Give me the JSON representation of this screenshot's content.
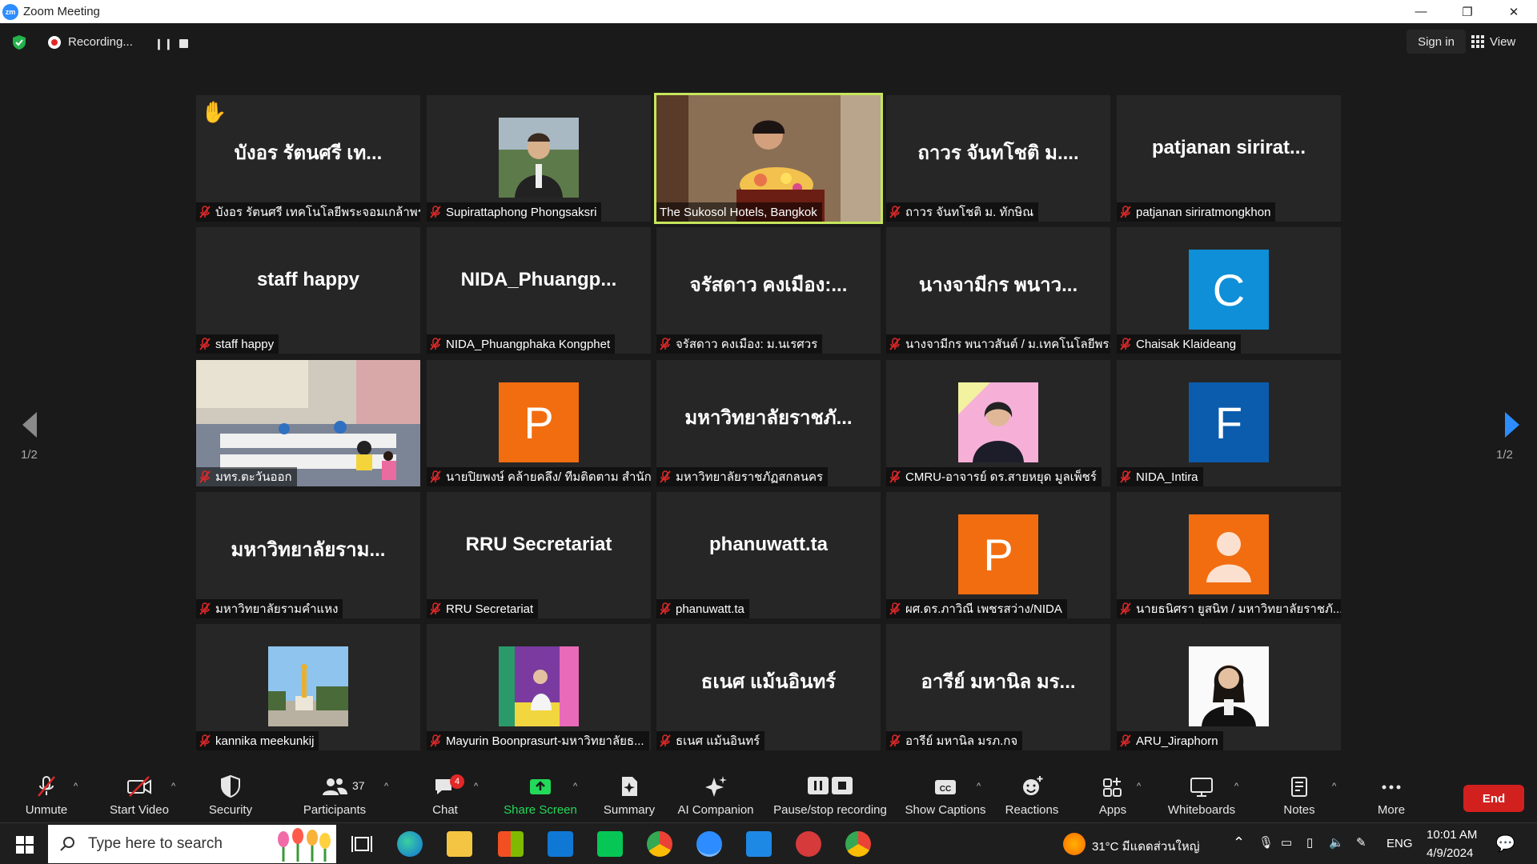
{
  "window": {
    "title": "Zoom Meeting",
    "logo_text": "zm",
    "minimize": "—",
    "restore": "❐",
    "close": "✕"
  },
  "topbar": {
    "recording_label": "Recording...",
    "signin_label": "Sign in",
    "view_label": "View"
  },
  "gallery": {
    "page_indicator_left": "1/2",
    "page_indicator_right": "1/2",
    "tiles": [
      {
        "display": "บังอร รัตนศรี เท...",
        "label": "บังอร รัตนศรี เทคโนโลยีพระจอมเกล้าพร...",
        "muted": true,
        "hand_raised": true
      },
      {
        "display": "",
        "label": "Supirattaphong Phongsaksri",
        "muted": true,
        "photo": "man-portrait"
      },
      {
        "display": "",
        "label": "The Sukosol Hotels, Bangkok",
        "muted": false,
        "photo": "speaker-podium",
        "speaking": true
      },
      {
        "display": "ถาวร จันทโชติ ม....",
        "label": "ถาวร จันทโชติ ม. ทักษิณ",
        "muted": true
      },
      {
        "display": "patjanan sirirat...",
        "label": "patjanan siriratmongkhon",
        "muted": true
      },
      {
        "display": "staff happy",
        "label": "staff happy",
        "muted": true
      },
      {
        "display": "NIDA_Phuangp...",
        "label": "NIDA_Phuangphaka Kongphet",
        "muted": true
      },
      {
        "display": "จรัสดาว คงเมือง:...",
        "label": "จรัสดาว คงเมือง: ม.นเรศวร",
        "muted": true
      },
      {
        "display": "นางจามีกร พนาว...",
        "label": "นางจามีกร พนาวสันต์ / ม.เทคโนโลยีพระ...",
        "muted": true
      },
      {
        "display": "",
        "label": "Chaisak Klaideang",
        "muted": true,
        "letter": "C",
        "letter_color": "#0e8fd8"
      },
      {
        "display": "",
        "label": "มทร.ตะวันออก",
        "muted": true,
        "photo": "classroom"
      },
      {
        "display": "",
        "label": "นายปิยพงษ์ คล้ายคลึง/ ทีมติดตาม สำนัก...",
        "muted": true,
        "letter": "P",
        "letter_color": "#f26d0f"
      },
      {
        "display": "มหาวิทยาลัยราชภั...",
        "label": "มหาวิทยาลัยราชภัฏสกลนคร",
        "muted": true
      },
      {
        "display": "",
        "label": "CMRU-อาจารย์ ดร.สายหยุด มูลเพ็ชร์",
        "muted": true,
        "photo": "woman-pink"
      },
      {
        "display": "",
        "label": "NIDA_Intira",
        "muted": true,
        "letter": "F",
        "letter_color": "#0b5cad"
      },
      {
        "display": "มหาวิทยาลัยราม...",
        "label": "มหาวิทยาลัยรามคำแหง",
        "muted": true
      },
      {
        "display": "RRU Secretariat",
        "label": "RRU Secretariat",
        "muted": true
      },
      {
        "display": "phanuwatt.ta",
        "label": "phanuwatt.ta",
        "muted": true
      },
      {
        "display": "",
        "label": "ผศ.ดร.ภาวิณี เพชรสว่าง/NIDA",
        "muted": true,
        "letter": "P",
        "letter_color": "#f26d0f"
      },
      {
        "display": "",
        "label": "นายธนิศรา ยูสนิท / มหาวิทยาลัยราชภั...",
        "muted": true,
        "letter": "person",
        "letter_color": "#f26d0f"
      },
      {
        "display": "",
        "label": "kannika meekunkij",
        "muted": true,
        "photo": "monument"
      },
      {
        "display": "",
        "label": "Mayurin Boonprasurt-มหาวิทยาลัยธ...",
        "muted": true,
        "photo": "colorful"
      },
      {
        "display": "ธเนศ แม้นอินทร์",
        "label": "ธเนศ แม้นอินทร์",
        "muted": true
      },
      {
        "display": "อารีย์ มหานิล มร...",
        "label": "อารีย์ มหานิล มรภ.กจ",
        "muted": true
      },
      {
        "display": "",
        "label": "ARU_Jiraphorn",
        "muted": true,
        "photo": "woman-formal"
      }
    ]
  },
  "toolbar": {
    "unmute": "Unmute",
    "start_video": "Start Video",
    "security": "Security",
    "participants": "Participants",
    "participants_count": "37",
    "chat": "Chat",
    "chat_badge": "4",
    "share_screen": "Share Screen",
    "summary": "Summary",
    "ai_companion": "AI Companion",
    "pause_stop": "Pause/stop recording",
    "show_captions": "Show Captions",
    "reactions": "Reactions",
    "apps": "Apps",
    "whiteboards": "Whiteboards",
    "notes": "Notes",
    "more": "More",
    "end": "End",
    "caption_icon_text": "CC",
    "caret": "^"
  },
  "taskbar": {
    "search_placeholder": "Type here to search",
    "weather": "31°C มีแดดส่วนใหญ่",
    "lang": "ENG",
    "time": "10:01 AM",
    "date": "4/9/2024"
  },
  "colors": {
    "accent_green": "#c6e65c",
    "end_red": "#d2201f",
    "share_green": "#23d959",
    "muted_red": "#e02828"
  }
}
